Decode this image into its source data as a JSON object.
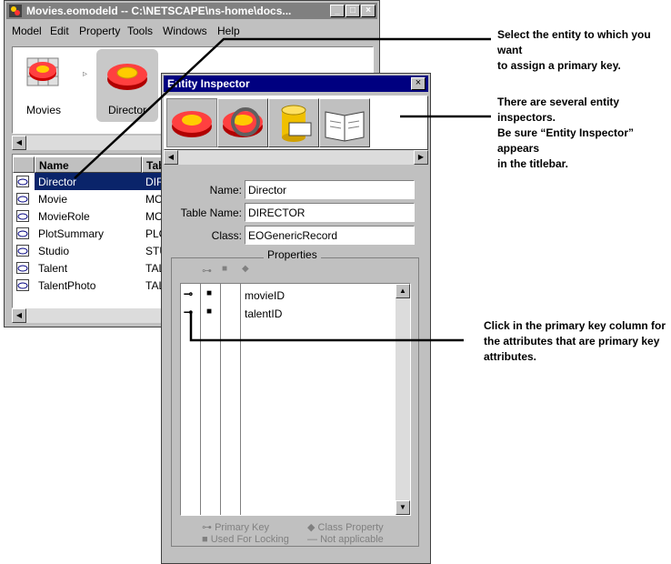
{
  "main_window": {
    "title": "Movies.eomodeld  --  C:\\NETSCAPE\\ns-home\\docs...",
    "menu": [
      "Model",
      "Edit",
      "Property",
      "Tools",
      "Windows",
      "Help"
    ],
    "entities_icons": [
      {
        "label": "Movies",
        "icon": "model-icon"
      },
      {
        "label": "Director",
        "icon": "entity-icon",
        "selected": true
      }
    ],
    "table": {
      "columns": [
        "Name",
        "Tab"
      ],
      "rows": [
        {
          "name": "Director",
          "table": "DIR",
          "selected": true
        },
        {
          "name": "Movie",
          "table": "MO"
        },
        {
          "name": "MovieRole",
          "table": "MO"
        },
        {
          "name": "PlotSummary",
          "table": "PLC"
        },
        {
          "name": "Studio",
          "table": "STU"
        },
        {
          "name": "Talent",
          "table": "TAL"
        },
        {
          "name": "TalentPhoto",
          "table": "TAL"
        }
      ]
    }
  },
  "inspector": {
    "title": "Entity Inspector",
    "tool_icons": [
      "entity-inspector-icon",
      "advanced-entity-icon",
      "stored-procedures-icon",
      "user-info-icon"
    ],
    "fields": [
      {
        "label": "Name:",
        "value": "Director"
      },
      {
        "label": "Table Name:",
        "value": "DIRECTOR"
      },
      {
        "label": "Class:",
        "value": "EOGenericRecord"
      }
    ],
    "properties_label": "Properties",
    "attributes": [
      {
        "name": "movieID",
        "primary_key": true,
        "locking": true
      },
      {
        "name": "talentID",
        "primary_key": true,
        "locking": true
      }
    ],
    "legend": {
      "primary_key": "Primary Key",
      "class_property": "Class Property",
      "used_for_locking": "Used For Locking",
      "not_applicable": "Not applicable"
    }
  },
  "annotations": {
    "select_entity": [
      "Select the entity to which you want",
      "to assign a primary key."
    ],
    "inspectors": [
      "There are several entity inspectors.",
      "Be sure “Entity Inspector” appears",
      "in the titlebar."
    ],
    "primary_key_col": [
      "Click in the primary key column for",
      "the attributes that are primary key",
      "attributes."
    ]
  }
}
